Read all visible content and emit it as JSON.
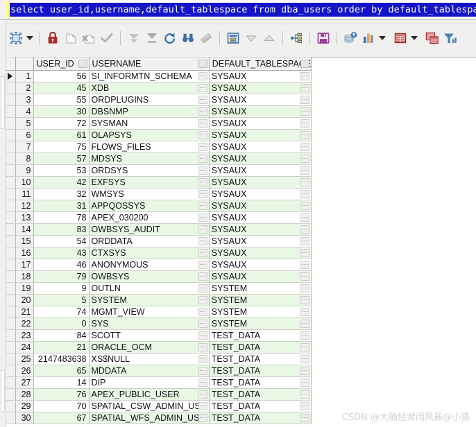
{
  "sql": {
    "query": "select user_id,username,default_tablespace from dba_users order by default_tablespace"
  },
  "toolbar": {
    "items": [
      {
        "name": "grid-mode-icon",
        "label": "Grid Mode"
      },
      {
        "name": "grid-mode-dropdown-icon",
        "label": "Grid Mode Options"
      },
      {
        "name": "lock-icon",
        "label": "Lock Record"
      },
      {
        "name": "insert-record-icon",
        "label": "Insert Record"
      },
      {
        "name": "delete-record-icon",
        "label": "Delete Record"
      },
      {
        "name": "post-edit-icon",
        "label": "Post Edit"
      },
      {
        "name": "fetch-next-page-icon",
        "label": "Fetch Next Page"
      },
      {
        "name": "fetch-all-icon",
        "label": "Fetch All Records"
      },
      {
        "name": "refresh-icon",
        "label": "Refresh"
      },
      {
        "name": "find-icon",
        "label": "Find"
      },
      {
        "name": "clear-filter-icon",
        "label": "Clear Filter"
      },
      {
        "name": "single-record-view-icon",
        "label": "Single Record View"
      },
      {
        "name": "move-down-icon",
        "label": "Move Down"
      },
      {
        "name": "move-up-icon",
        "label": "Move Up"
      },
      {
        "name": "export-structure-icon",
        "label": "Show Structure"
      },
      {
        "name": "save-icon",
        "label": "Save Data"
      },
      {
        "name": "export-data-icon",
        "label": "Export Data"
      },
      {
        "name": "chart-icon",
        "label": "Chart"
      },
      {
        "name": "chart-dropdown-icon",
        "label": "Chart Options"
      },
      {
        "name": "grid-report-icon",
        "label": "Report"
      },
      {
        "name": "grid-report-dropdown-icon",
        "label": "Report Options"
      },
      {
        "name": "copy-rows-icon",
        "label": "Copy Rows"
      },
      {
        "name": "filter-icon",
        "label": "Filter Data"
      }
    ]
  },
  "grid": {
    "columns": [
      {
        "key": "user_id",
        "label": "USER_ID"
      },
      {
        "key": "username",
        "label": "USERNAME"
      },
      {
        "key": "default_tablespace",
        "label": "DEFAULT_TABLESPACE"
      }
    ],
    "cell_overflow_glyph": "···",
    "selected_row": 1,
    "rows": [
      {
        "n": "1",
        "user_id": "56",
        "username": "SI_INFORMTN_SCHEMA",
        "default_tablespace": "SYSAUX"
      },
      {
        "n": "2",
        "user_id": "45",
        "username": "XDB",
        "default_tablespace": "SYSAUX"
      },
      {
        "n": "3",
        "user_id": "55",
        "username": "ORDPLUGINS",
        "default_tablespace": "SYSAUX"
      },
      {
        "n": "4",
        "user_id": "30",
        "username": "DBSNMP",
        "default_tablespace": "SYSAUX"
      },
      {
        "n": "5",
        "user_id": "72",
        "username": "SYSMAN",
        "default_tablespace": "SYSAUX"
      },
      {
        "n": "6",
        "user_id": "61",
        "username": "OLAPSYS",
        "default_tablespace": "SYSAUX"
      },
      {
        "n": "7",
        "user_id": "75",
        "username": "FLOWS_FILES",
        "default_tablespace": "SYSAUX"
      },
      {
        "n": "8",
        "user_id": "57",
        "username": "MDSYS",
        "default_tablespace": "SYSAUX"
      },
      {
        "n": "9",
        "user_id": "53",
        "username": "ORDSYS",
        "default_tablespace": "SYSAUX"
      },
      {
        "n": "10",
        "user_id": "42",
        "username": "EXFSYS",
        "default_tablespace": "SYSAUX"
      },
      {
        "n": "11",
        "user_id": "32",
        "username": "WMSYS",
        "default_tablespace": "SYSAUX"
      },
      {
        "n": "12",
        "user_id": "31",
        "username": "APPQOSSYS",
        "default_tablespace": "SYSAUX"
      },
      {
        "n": "13",
        "user_id": "78",
        "username": "APEX_030200",
        "default_tablespace": "SYSAUX"
      },
      {
        "n": "14",
        "user_id": "83",
        "username": "OWBSYS_AUDIT",
        "default_tablespace": "SYSAUX"
      },
      {
        "n": "15",
        "user_id": "54",
        "username": "ORDDATA",
        "default_tablespace": "SYSAUX"
      },
      {
        "n": "16",
        "user_id": "43",
        "username": "CTXSYS",
        "default_tablespace": "SYSAUX"
      },
      {
        "n": "17",
        "user_id": "46",
        "username": "ANONYMOUS",
        "default_tablespace": "SYSAUX"
      },
      {
        "n": "18",
        "user_id": "79",
        "username": "OWBSYS",
        "default_tablespace": "SYSAUX"
      },
      {
        "n": "19",
        "user_id": "9",
        "username": "OUTLN",
        "default_tablespace": "SYSTEM"
      },
      {
        "n": "20",
        "user_id": "5",
        "username": "SYSTEM",
        "default_tablespace": "SYSTEM"
      },
      {
        "n": "21",
        "user_id": "74",
        "username": "MGMT_VIEW",
        "default_tablespace": "SYSTEM"
      },
      {
        "n": "22",
        "user_id": "0",
        "username": "SYS",
        "default_tablespace": "SYSTEM"
      },
      {
        "n": "23",
        "user_id": "84",
        "username": "SCOTT",
        "default_tablespace": "TEST_DATA"
      },
      {
        "n": "24",
        "user_id": "21",
        "username": "ORACLE_OCM",
        "default_tablespace": "TEST_DATA"
      },
      {
        "n": "25",
        "user_id": "2147483638",
        "username": "XS$NULL",
        "default_tablespace": "TEST_DATA"
      },
      {
        "n": "26",
        "user_id": "65",
        "username": "MDDATA",
        "default_tablespace": "TEST_DATA"
      },
      {
        "n": "27",
        "user_id": "14",
        "username": "DIP",
        "default_tablespace": "TEST_DATA"
      },
      {
        "n": "28",
        "user_id": "76",
        "username": "APEX_PUBLIC_USER",
        "default_tablespace": "TEST_DATA"
      },
      {
        "n": "29",
        "user_id": "70",
        "username": "SPATIAL_CSW_ADMIN_USR",
        "default_tablespace": "TEST_DATA"
      },
      {
        "n": "30",
        "user_id": "67",
        "username": "SPATIAL_WFS_ADMIN_USR",
        "default_tablespace": "TEST_DATA"
      }
    ]
  },
  "watermark": {
    "text": "CSDN @大脑经常闹风暴@小猿"
  },
  "colors": {
    "sql_background": "#1414c8",
    "sql_text": "#ffffff",
    "row_alt": "#e9f8e4",
    "row_number_text": "#7a5c2e",
    "toolbar_background": "#f0f0ee"
  }
}
